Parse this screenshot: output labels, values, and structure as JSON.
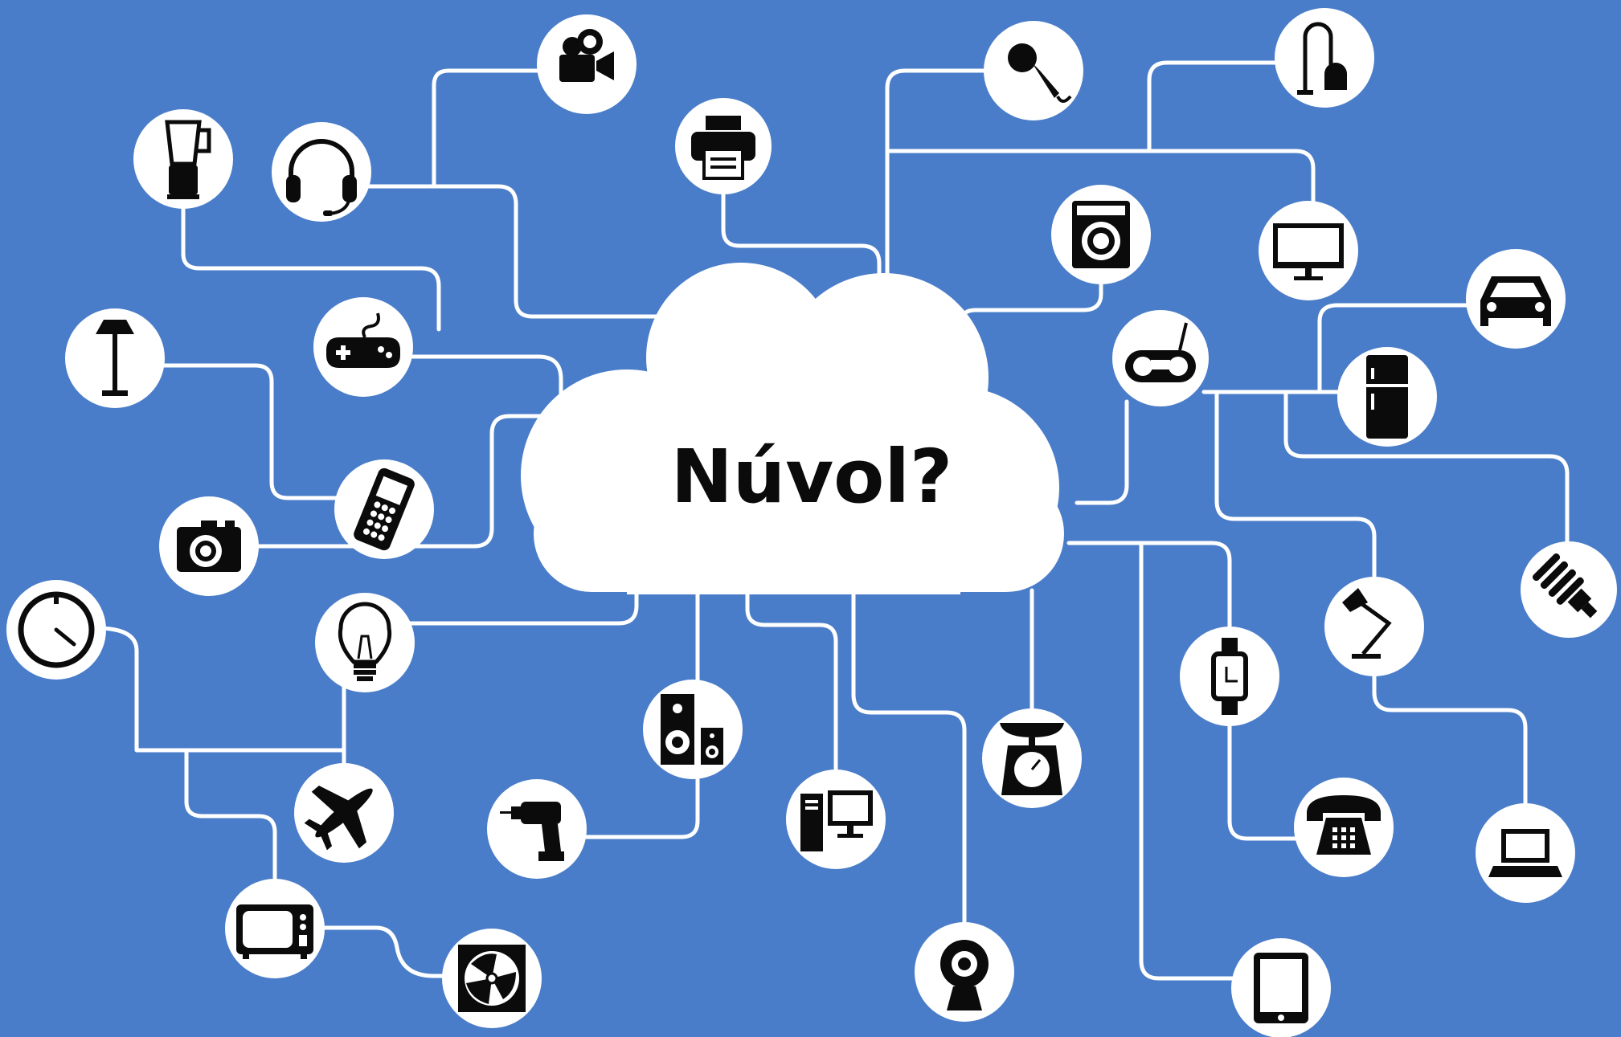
{
  "cloud": {
    "label": "Núvol?"
  },
  "colors": {
    "background": "#4a7dc9",
    "line": "#ffffff",
    "node": "#ffffff",
    "icon": "#0b0b0b"
  },
  "devices": [
    {
      "id": "video-camera",
      "icon": "video-camera-icon"
    },
    {
      "id": "printer",
      "icon": "printer-icon"
    },
    {
      "id": "blender",
      "icon": "blender-icon"
    },
    {
      "id": "headset",
      "icon": "headset-icon"
    },
    {
      "id": "microphone",
      "icon": "microphone-icon"
    },
    {
      "id": "vacuum-cleaner",
      "icon": "vacuum-cleaner-icon"
    },
    {
      "id": "washing-machine",
      "icon": "washing-machine-icon"
    },
    {
      "id": "monitor",
      "icon": "monitor-icon"
    },
    {
      "id": "car",
      "icon": "car-icon"
    },
    {
      "id": "floor-lamp",
      "icon": "floor-lamp-icon"
    },
    {
      "id": "gamepad",
      "icon": "gamepad-icon"
    },
    {
      "id": "radio",
      "icon": "radio-icon"
    },
    {
      "id": "refrigerator",
      "icon": "refrigerator-icon"
    },
    {
      "id": "mobile-phone",
      "icon": "mobile-phone-icon"
    },
    {
      "id": "camera",
      "icon": "camera-icon"
    },
    {
      "id": "energy-saving-bulb",
      "icon": "energy-saving-bulb-icon"
    },
    {
      "id": "clock",
      "icon": "clock-icon"
    },
    {
      "id": "light-bulb",
      "icon": "light-bulb-icon"
    },
    {
      "id": "desk-lamp",
      "icon": "desk-lamp-icon"
    },
    {
      "id": "wristwatch",
      "icon": "wristwatch-icon"
    },
    {
      "id": "speakers",
      "icon": "speakers-icon"
    },
    {
      "id": "kitchen-scale",
      "icon": "kitchen-scale-icon"
    },
    {
      "id": "airplane",
      "icon": "airplane-icon"
    },
    {
      "id": "drill",
      "icon": "drill-icon"
    },
    {
      "id": "desktop-computer",
      "icon": "desktop-computer-icon"
    },
    {
      "id": "telephone",
      "icon": "telephone-icon"
    },
    {
      "id": "laptop",
      "icon": "laptop-icon"
    },
    {
      "id": "television",
      "icon": "television-icon"
    },
    {
      "id": "fan",
      "icon": "fan-icon"
    },
    {
      "id": "webcam",
      "icon": "webcam-icon"
    },
    {
      "id": "tablet",
      "icon": "tablet-icon"
    }
  ]
}
